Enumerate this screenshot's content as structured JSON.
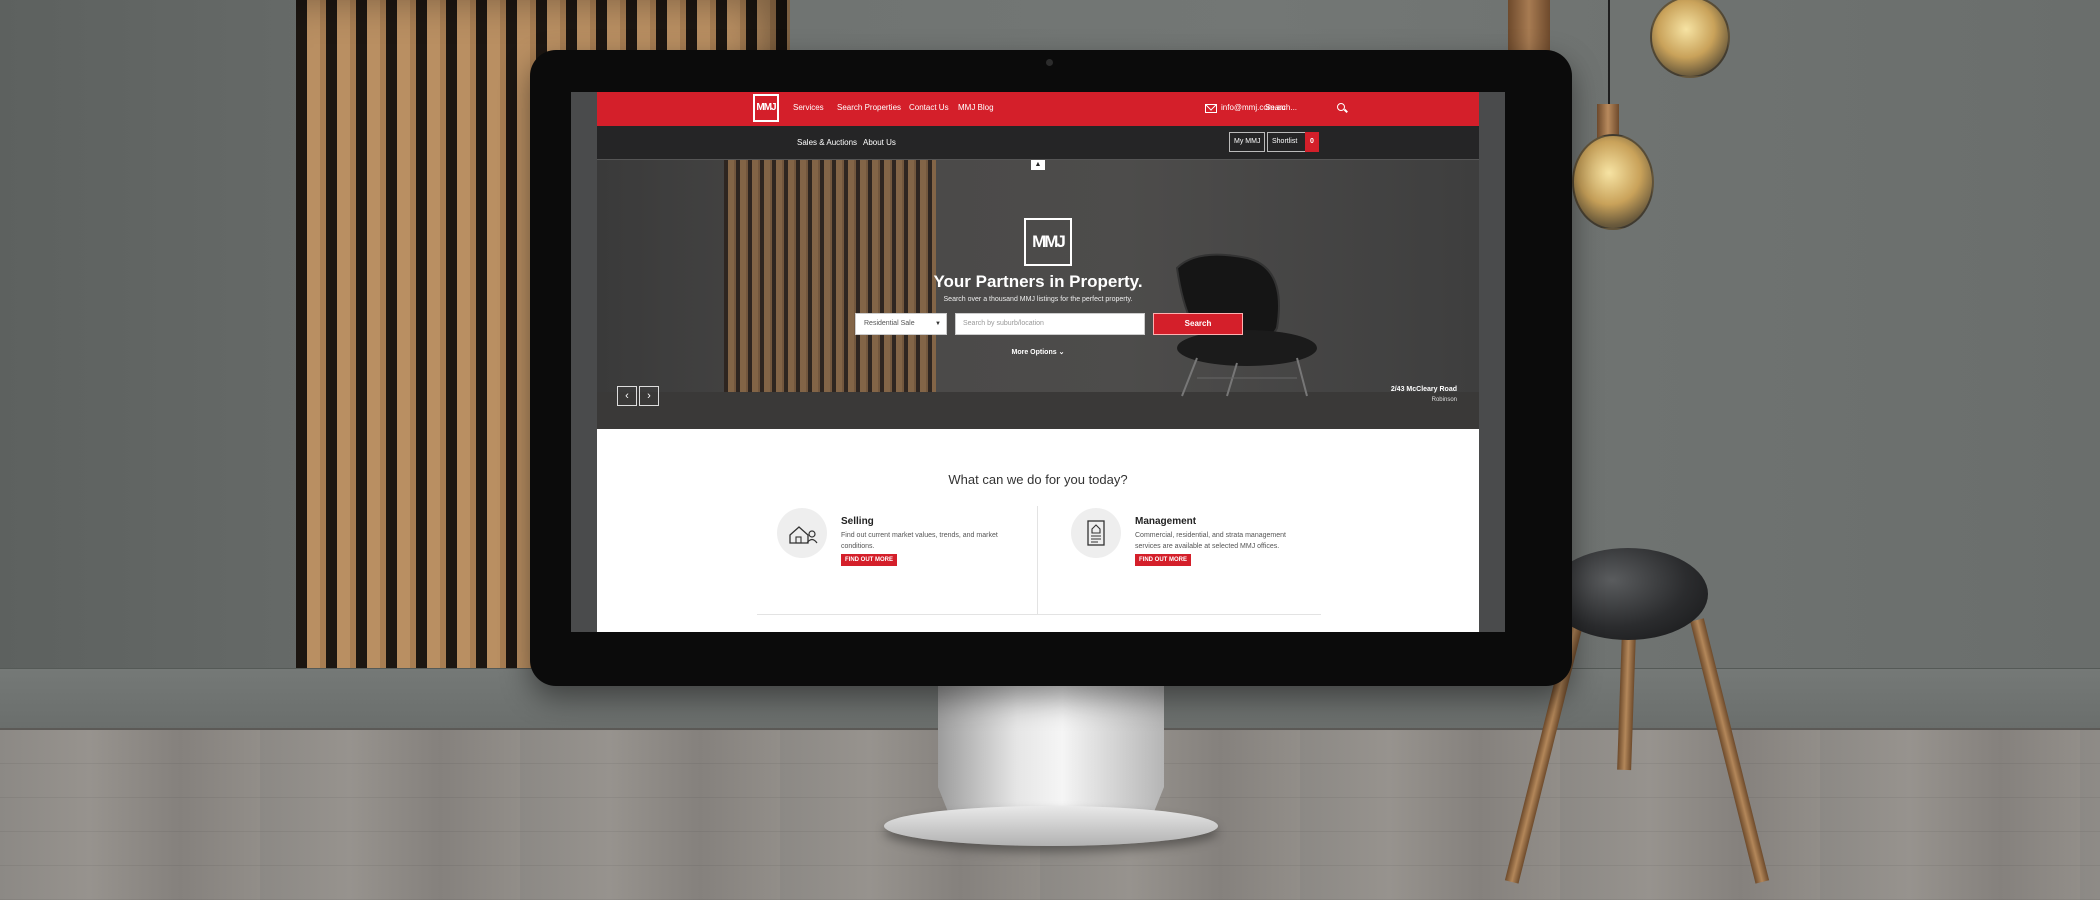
{
  "nav": {
    "logo_text": "MMJ",
    "links": [
      "Services",
      "Search Properties",
      "Contact Us",
      "MMJ Blog"
    ],
    "email": "info@mmj.com.au",
    "search_placeholder": "Search..."
  },
  "subnav": {
    "links": [
      "Sales & Auctions",
      "About Us"
    ],
    "my_account": "My MMJ",
    "shortlist_label": "Shortlist",
    "shortlist_count": "0"
  },
  "hero": {
    "logo_text": "MMJ",
    "title": "Your Partners in Property.",
    "subtitle": "Search over a thousand MMJ listings for the perfect property.",
    "select_value": "Residential Sale",
    "location_placeholder": "Search by suburb/location",
    "search_button": "Search",
    "more_options": "More Options",
    "caption_title": "2/43 McCleary Road",
    "caption_sub": "Robinson"
  },
  "services": {
    "heading": "What can we do for you today?",
    "items": [
      {
        "title": "Selling",
        "description": "Find out current market values, trends, and market conditions.",
        "button": "FIND OUT MORE",
        "icon": "house-person-icon"
      },
      {
        "title": "Management",
        "description": "Commercial, residential, and strata management services are available at selected MMJ offices.",
        "button": "FIND OUT MORE",
        "icon": "document-house-icon"
      }
    ]
  },
  "colors": {
    "brand_red": "#d41f2a",
    "dark_nav": "#252526"
  }
}
